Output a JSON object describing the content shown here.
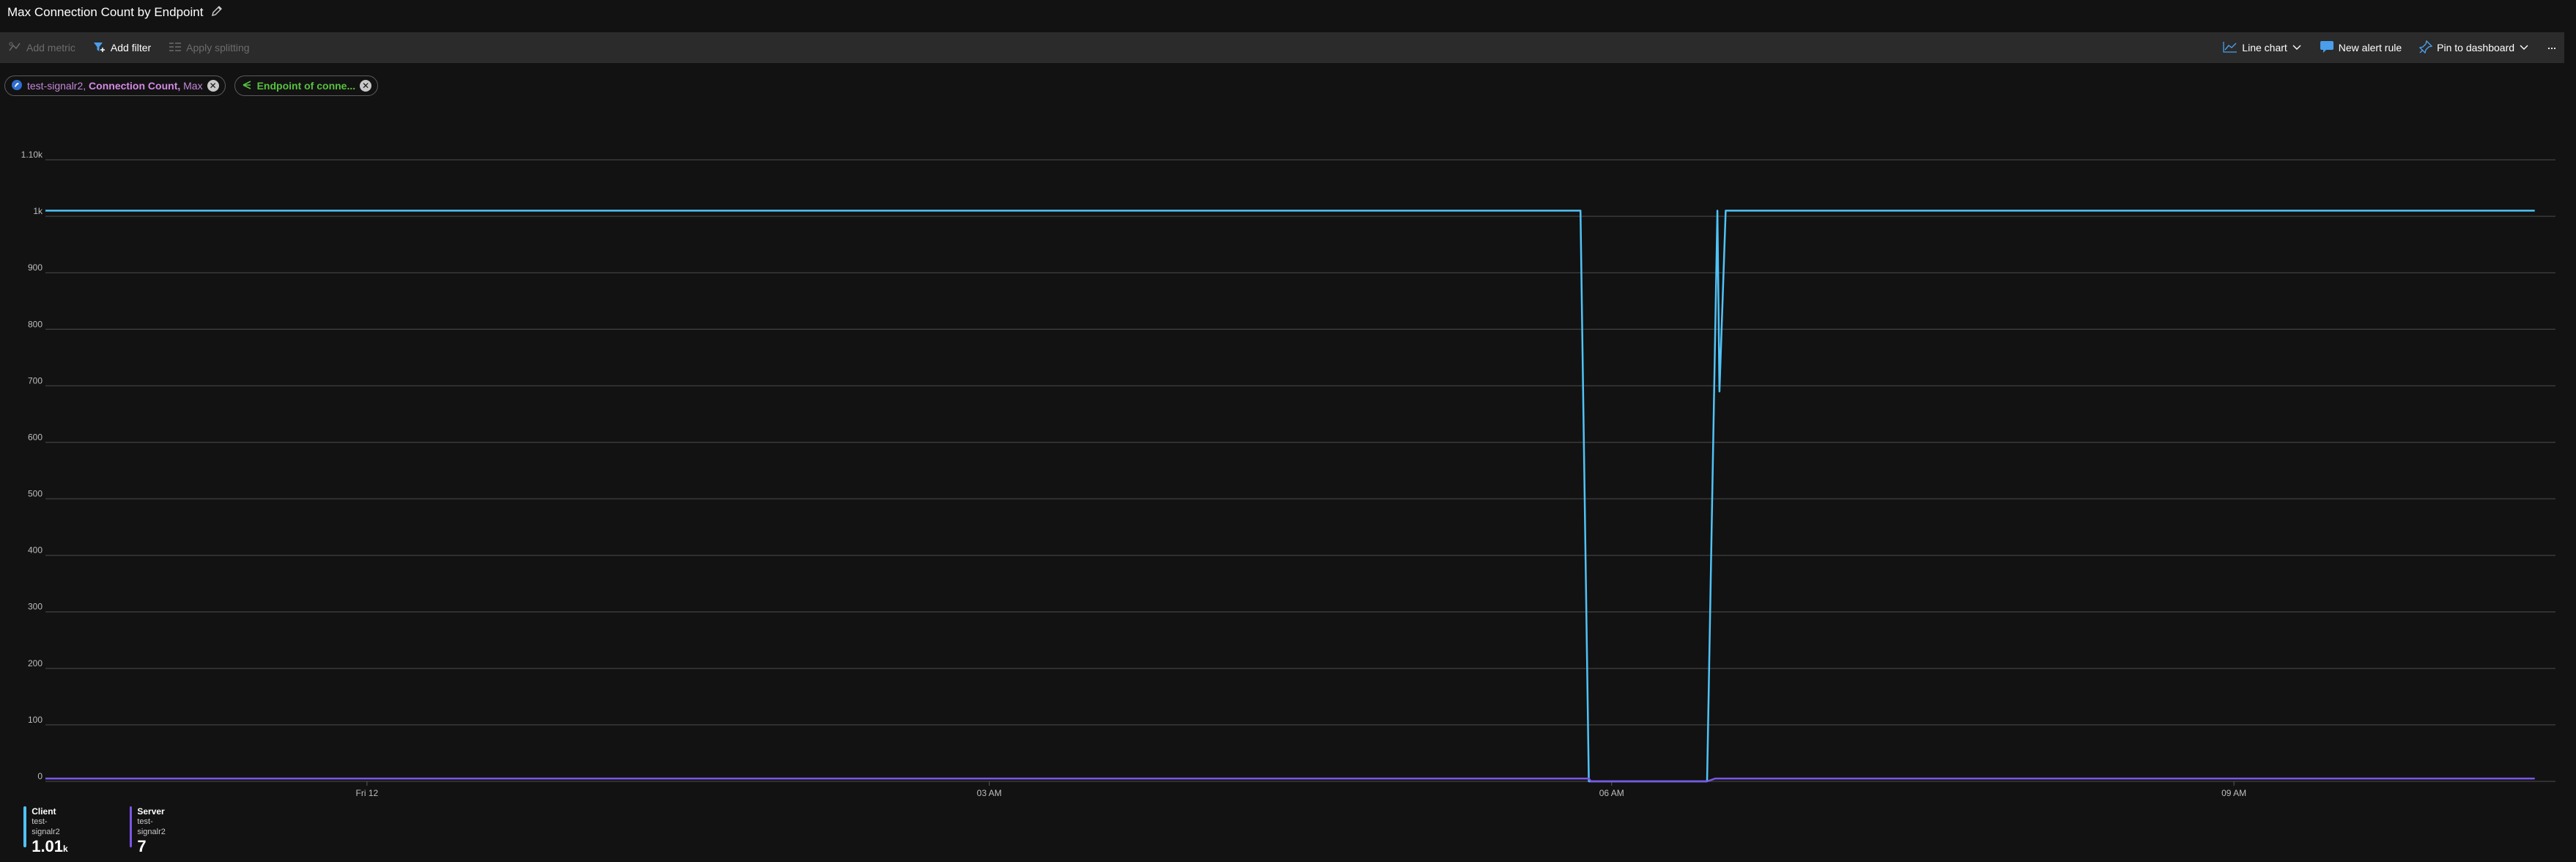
{
  "page": {
    "title": "Max Connection Count by Endpoint"
  },
  "toolbar": {
    "add_metric": "Add metric",
    "add_filter": "Add filter",
    "apply_splitting": "Apply splitting",
    "line_chart": "Line chart",
    "new_alert_rule": "New alert rule",
    "pin_to_dashboard": "Pin to dashboard",
    "more": "···"
  },
  "pills": {
    "metric": {
      "resource": "test-signalr2,",
      "metric": "Connection Count,",
      "aggregation": "Max"
    },
    "splitting": {
      "label": "Endpoint of conne..."
    }
  },
  "colors": {
    "client_series": "#4fc3f7",
    "server_series": "#7b57e8",
    "gridline": "#3a3a3a",
    "toolbar_bg": "#2b2b2b",
    "page_bg": "#121212"
  },
  "chart_data": {
    "type": "line",
    "y_ticks": [
      "0",
      "100",
      "200",
      "300",
      "400",
      "500",
      "600",
      "700",
      "800",
      "900",
      "1k",
      "1.10k"
    ],
    "ylim": [
      0,
      1100
    ],
    "x_ticks": [
      "Fri 12",
      "03 AM",
      "06 AM",
      "09 AM"
    ],
    "x_tick_hours": [
      0,
      3,
      6,
      9
    ],
    "xlim_hours": [
      -1.55,
      10.55
    ],
    "grid": true,
    "legend_position": "bottom-left",
    "series": [
      {
        "name": "Client",
        "resource": "test-signalr2",
        "value_label": "1.01",
        "value_unit": "k",
        "points": [
          [
            -1.55,
            1010
          ],
          [
            5.85,
            1010
          ],
          [
            5.89,
            0
          ],
          [
            6.46,
            0
          ],
          [
            6.51,
            1010
          ],
          [
            6.52,
            690
          ],
          [
            6.55,
            1010
          ],
          [
            10.45,
            1010
          ]
        ]
      },
      {
        "name": "Server",
        "resource": "test-signalr2",
        "value_label": "7",
        "value_unit": "",
        "points": [
          [
            -1.55,
            5
          ],
          [
            5.89,
            5
          ],
          [
            5.9,
            0
          ],
          [
            6.46,
            0
          ],
          [
            6.5,
            5
          ],
          [
            10.45,
            5
          ]
        ]
      }
    ]
  }
}
